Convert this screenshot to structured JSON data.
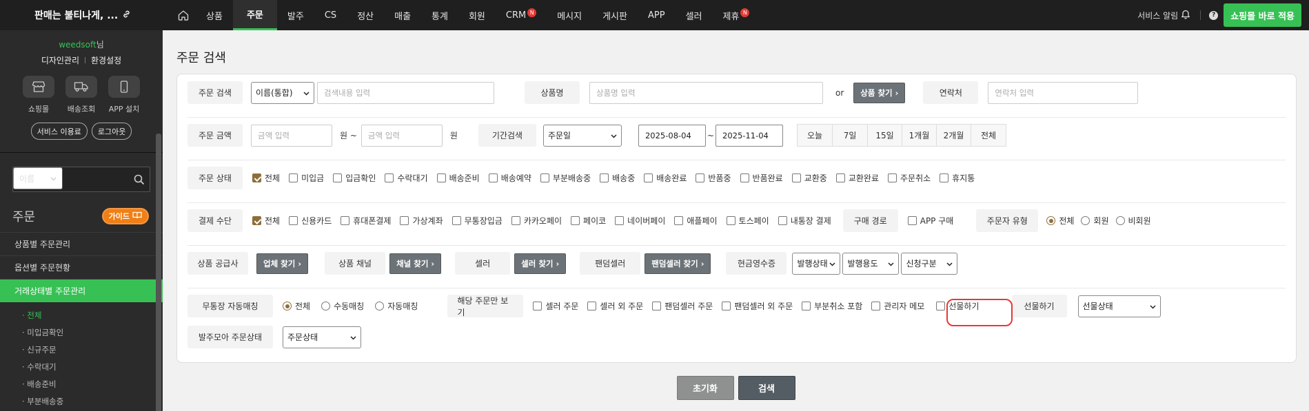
{
  "app": {
    "store_name": "판매는 불티나게, ...",
    "link_icon": "link-icon"
  },
  "nav": {
    "home_icon": "home-icon",
    "items": [
      {
        "label": "상품"
      },
      {
        "label": "주문",
        "active": true
      },
      {
        "label": "발주"
      },
      {
        "label": "CS"
      },
      {
        "label": "정산"
      },
      {
        "label": "매출"
      },
      {
        "label": "통계"
      },
      {
        "label": "회원"
      },
      {
        "label": "CRM",
        "badge": "N"
      },
      {
        "label": "메시지"
      },
      {
        "label": "게시판"
      },
      {
        "label": "APP"
      },
      {
        "label": "셀러"
      },
      {
        "label": "제휴",
        "badge": "N"
      }
    ],
    "service_alert": "서비스 알림",
    "help": "?",
    "apply_button": "쇼핑몰 바로 적용"
  },
  "sidebar": {
    "user": "weedsoft",
    "user_suffix": "님",
    "link_design": "디자인관리",
    "link_settings": "환경설정",
    "icons": [
      {
        "icon": "store-icon",
        "label": "쇼핑몰"
      },
      {
        "icon": "truck-icon",
        "label": "배송조회"
      },
      {
        "icon": "phone-icon",
        "label": "APP 설치"
      }
    ],
    "service_fee": "서비스 이용료",
    "logout": "로그아웃",
    "search_type": "이름",
    "section_title": "주문",
    "guide": "가이드",
    "menu": [
      {
        "label": "상품별 주문관리"
      },
      {
        "label": "옵션별 주문현황"
      },
      {
        "label": "거래상태별 주문관리",
        "active": true
      }
    ],
    "submenu": [
      {
        "label": "· 전체",
        "active": true
      },
      {
        "label": "· 미입금확인"
      },
      {
        "label": "· 신규주문"
      },
      {
        "label": "· 수락대기"
      },
      {
        "label": "· 배송준비"
      },
      {
        "label": "· 부분배송중"
      }
    ]
  },
  "page": {
    "title": "주문 검색",
    "row1": {
      "order_search_label": "주문 검색",
      "order_search_type": "이름(통합)",
      "order_search_placeholder": "검색내용 입력",
      "product_label": "상품명",
      "product_placeholder": "상품명 입력",
      "or_text": "or",
      "find_product_button": "상품 찾기 ›",
      "contact_label": "연락처",
      "contact_placeholder": "연락처 입력"
    },
    "row2": {
      "amount_label": "주문 금액",
      "amount_from_placeholder": "금액 입력",
      "won_tilde": "원 ~",
      "amount_to_placeholder": "금액 입력",
      "won": "원",
      "period_label": "기간검색",
      "period_type": "주문일",
      "date_from": "2025-08-04",
      "tilde": "~",
      "date_to": "2025-11-04",
      "quick_periods": [
        "오늘",
        "7일",
        "15일",
        "1개월",
        "2개월",
        "전체"
      ]
    },
    "row3": {
      "status_label": "주문 상태",
      "statuses": [
        {
          "label": "전체",
          "checked": true
        },
        {
          "label": "미입금"
        },
        {
          "label": "입금확인"
        },
        {
          "label": "수락대기"
        },
        {
          "label": "배송준비"
        },
        {
          "label": "배송예약"
        },
        {
          "label": "부분배송중"
        },
        {
          "label": "배송중"
        },
        {
          "label": "배송완료"
        },
        {
          "label": "반품중"
        },
        {
          "label": "반품완료"
        },
        {
          "label": "교환중"
        },
        {
          "label": "교환완료"
        },
        {
          "label": "주문취소"
        },
        {
          "label": "휴지통"
        }
      ]
    },
    "row4": {
      "payment_label": "결제 수단",
      "payments": [
        {
          "label": "전체",
          "checked": true
        },
        {
          "label": "신용카드"
        },
        {
          "label": "휴대폰결제"
        },
        {
          "label": "가상계좌"
        },
        {
          "label": "무통장입금"
        },
        {
          "label": "카카오페이"
        },
        {
          "label": "페이코"
        },
        {
          "label": "네이버페이"
        },
        {
          "label": "애플페이"
        },
        {
          "label": "토스페이"
        },
        {
          "label": "내통장 결제"
        }
      ],
      "route_label": "구매 경로",
      "app_purchase": "APP 구매",
      "buyer_type_label": "주문자 유형",
      "buyer_types": [
        {
          "label": "전체",
          "checked": true
        },
        {
          "label": "회원"
        },
        {
          "label": "비회원"
        }
      ]
    },
    "row5": {
      "supplier_label": "상품 공급사",
      "find_supplier": "업체 찾기 ›",
      "channel_label": "상품 채널",
      "find_channel": "채널 찾기 ›",
      "seller_label": "셀러",
      "find_seller": "셀러 찾기 ›",
      "fandom_label": "팬덤셀러",
      "find_fandom": "팬덤셀러 찾기 ›",
      "receipt_label": "현금영수증",
      "receipt_status": "발행상태",
      "receipt_purpose": "발행용도",
      "receipt_request": "신청구분"
    },
    "row6": {
      "bank_match_label": "무통장 자동매칭",
      "bank_match": [
        {
          "label": "전체",
          "checked": true
        },
        {
          "label": "수동매칭"
        },
        {
          "label": "자동매칭"
        }
      ],
      "view_only_label": "해당 주문만 보기",
      "view_only": [
        {
          "label": "셀러 주문"
        },
        {
          "label": "셀러 외 주문"
        },
        {
          "label": "팬덤셀러 주문"
        },
        {
          "label": "팬덤셀러 외 주문"
        },
        {
          "label": "부분취소 포함"
        },
        {
          "label": "관리자 메모"
        }
      ],
      "gift_checkbox": "선물하기",
      "gift_label": "선물하기",
      "gift_status": "선물상태"
    },
    "row7": {
      "baljumoa_label": "발주모아 주문상태",
      "baljumoa_status": "주문상태"
    },
    "buttons": {
      "reset": "초기화",
      "search": "검색"
    }
  },
  "colors": {
    "accent_green": "#37c155",
    "highlight_red": "#e53935",
    "badge_red": "#e53935",
    "guide_orange": "#f07f16"
  }
}
